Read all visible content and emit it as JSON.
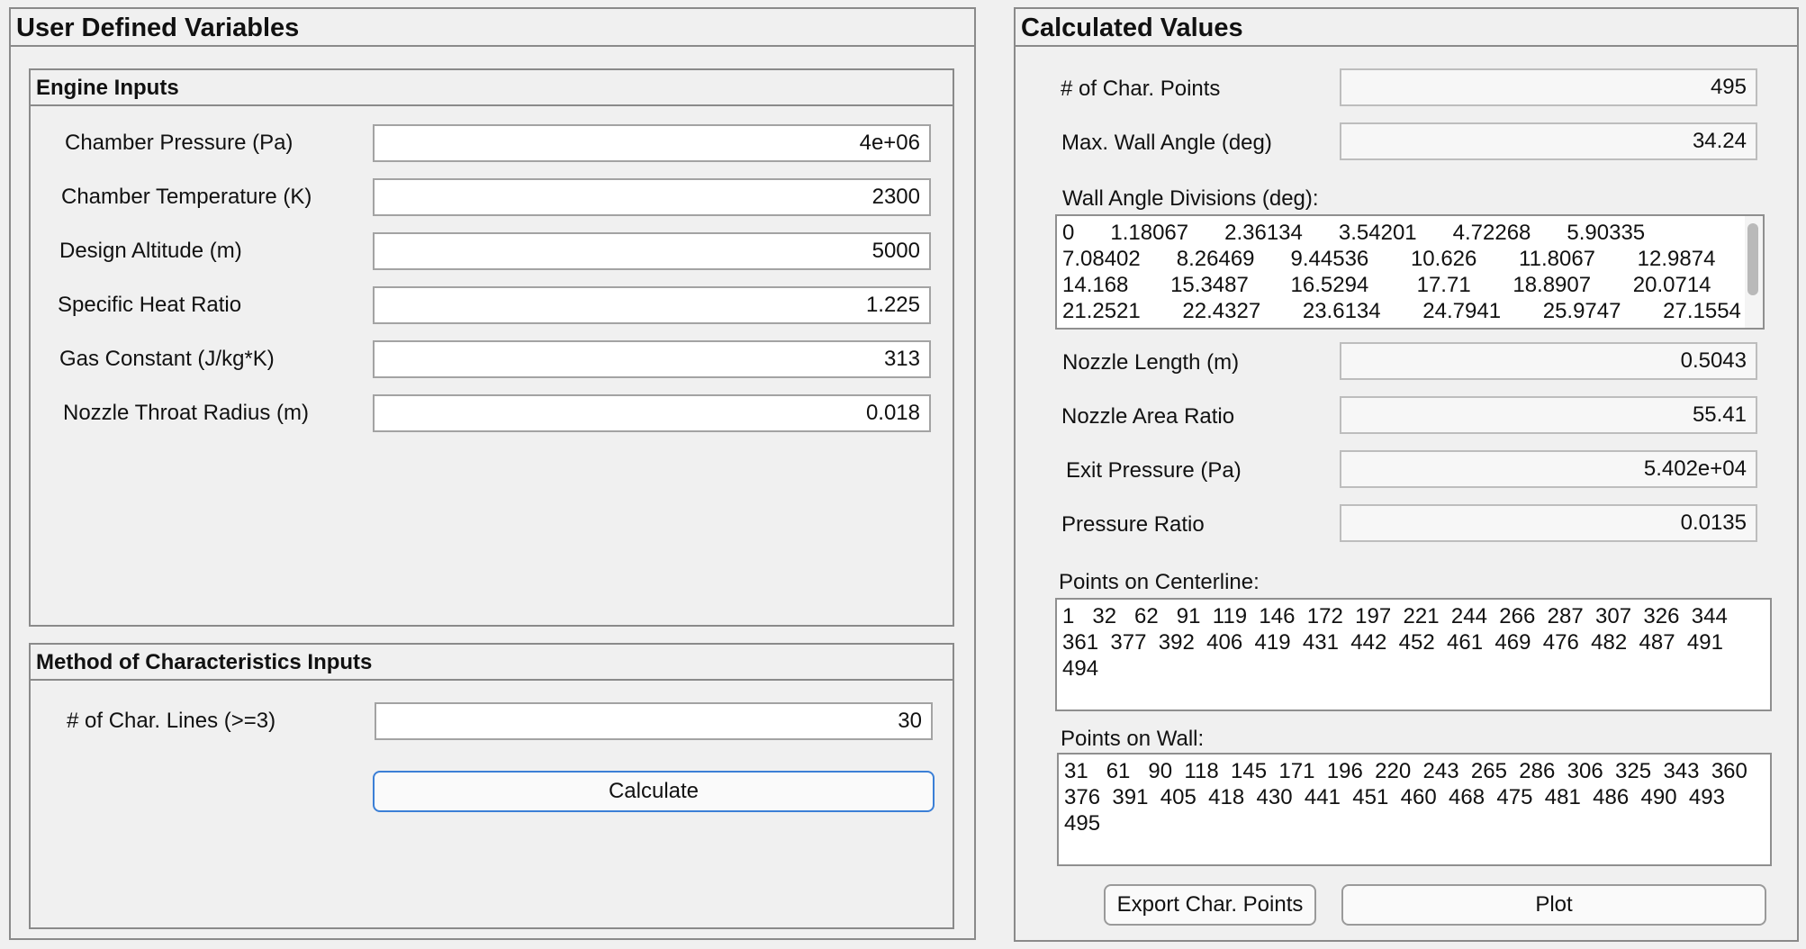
{
  "left_panel": {
    "title": "User Defined Variables",
    "engine_inputs": {
      "title": "Engine Inputs",
      "fields": [
        {
          "label": "Chamber Pressure (Pa)",
          "value": "4e+06"
        },
        {
          "label": "Chamber Temperature (K)",
          "value": "2300"
        },
        {
          "label": "Design Altitude (m)",
          "value": "5000"
        },
        {
          "label": "Specific Heat Ratio",
          "value": "1.225"
        },
        {
          "label": "Gas Constant (J/kg*K)",
          "value": "313"
        },
        {
          "label": "Nozzle Throat Radius (m)",
          "value": "0.018"
        }
      ]
    },
    "moc_inputs": {
      "title": "Method of Characteristics Inputs",
      "char_lines_label": "# of Char. Lines (>=3)",
      "char_lines_value": "30",
      "calculate_label": "Calculate"
    }
  },
  "right_panel": {
    "title": "Calculated Values",
    "char_points": {
      "label": "# of Char. Points",
      "value": "495"
    },
    "max_wall_angle": {
      "label": "Max. Wall Angle (deg)",
      "value": "34.24"
    },
    "wall_angle_divisions": {
      "label": "Wall Angle Divisions (deg):",
      "text": "0      1.18067      2.36134      3.54201      4.72268      5.90335\n7.08402      8.26469      9.44536       10.626       11.8067       12.9874\n14.168       15.3487       16.5294        17.71       18.8907       20.0714\n21.2521       22.4327       23.6134       24.7941       25.9747       27.1554"
    },
    "nozzle_length": {
      "label": "Nozzle Length (m)",
      "value": "0.5043"
    },
    "nozzle_area_ratio": {
      "label": "Nozzle Area Ratio",
      "value": "55.41"
    },
    "exit_pressure": {
      "label": "Exit Pressure (Pa)",
      "value": "5.402e+04"
    },
    "pressure_ratio": {
      "label": "Pressure Ratio",
      "value": "0.0135"
    },
    "points_centerline": {
      "label": "Points on Centerline:",
      "text": "1   32   62   91  119  146  172  197  221  244  266  287  307  326  344\n361  377  392  406  419  431  442  452  461  469  476  482  487  491\n494"
    },
    "points_wall": {
      "label": "Points on Wall:",
      "text": "31   61   90  118  145  171  196  220  243  265  286  306  325  343  360\n376  391  405  418  430  441  451  460  468  475  481  486  490  493\n495"
    },
    "export_label": "Export Char. Points",
    "plot_label": "Plot"
  }
}
